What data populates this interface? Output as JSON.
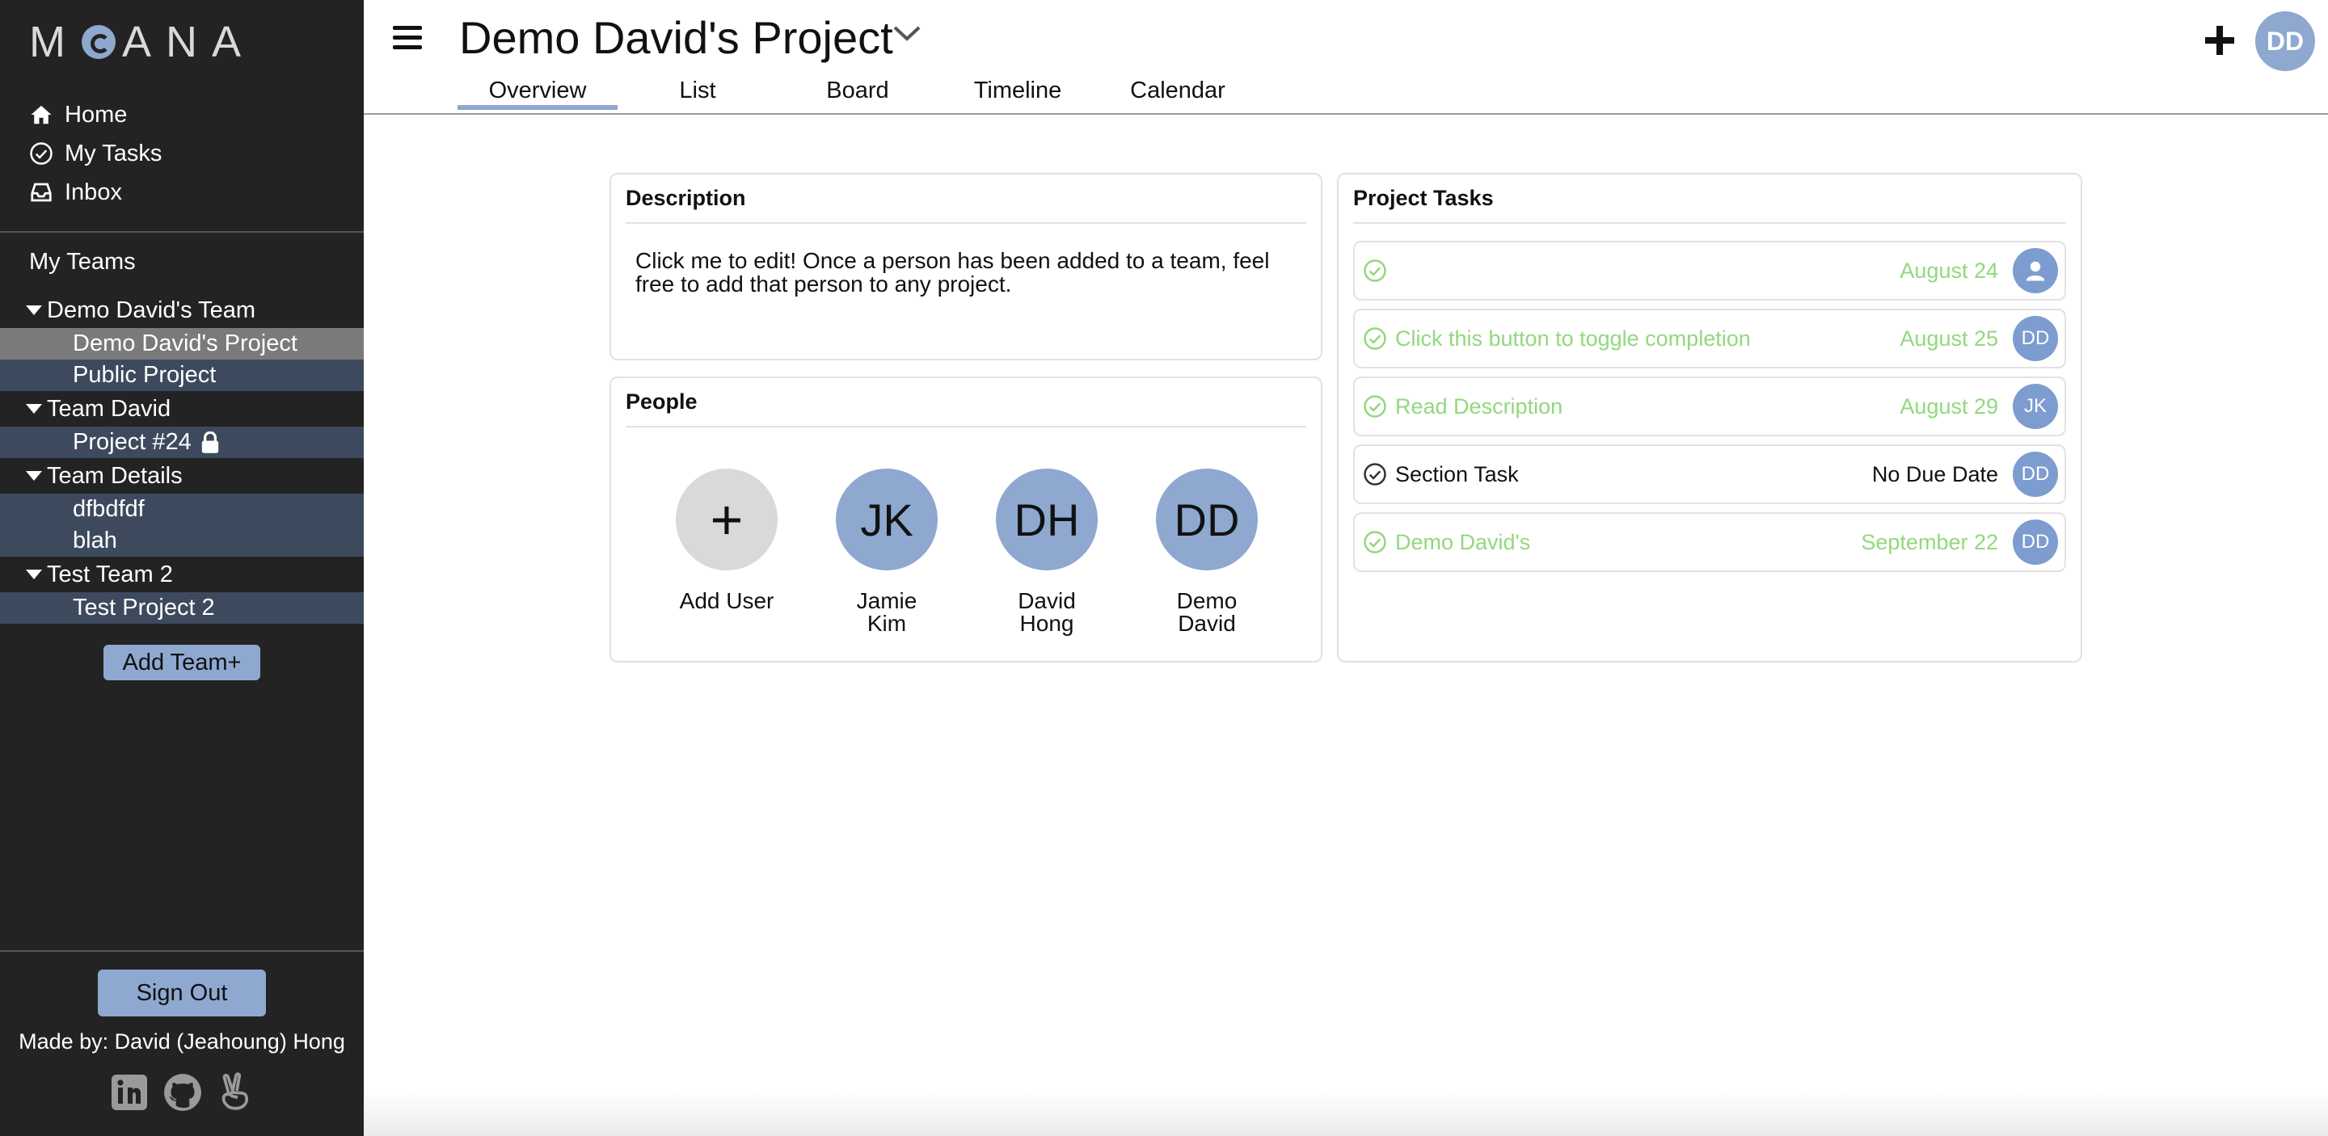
{
  "app": {
    "logo_text_left": "M",
    "logo_text_right": "ANA"
  },
  "sidebar": {
    "nav": [
      {
        "label": "Home",
        "icon": "home-icon"
      },
      {
        "label": "My Tasks",
        "icon": "check-circle-icon"
      },
      {
        "label": "Inbox",
        "icon": "inbox-icon"
      }
    ],
    "my_teams_label": "My Teams",
    "teams": [
      {
        "name": "Demo David's Team",
        "projects": [
          "Demo David's Project",
          "Public Project"
        ]
      },
      {
        "name": "Team David",
        "projects": [
          "Project #24"
        ]
      },
      {
        "name": "Team Details",
        "projects": [
          "dfbdfdf",
          "blah"
        ]
      },
      {
        "name": "Test Team 2",
        "projects": [
          "Test Project 2"
        ]
      }
    ],
    "add_team_label": "Add Team+",
    "sign_out_label": "Sign Out",
    "made_by": "Made by: David (Jeahoung) Hong"
  },
  "header": {
    "project_title": "Demo David's Project",
    "tabs": [
      "Overview",
      "List",
      "Board",
      "Timeline",
      "Calendar"
    ],
    "active_tab": "Overview",
    "user_initials": "DD"
  },
  "description": {
    "title": "Description",
    "text": "Click me to edit! Once a person has been added to a team, feel free to add that person to any project."
  },
  "people": {
    "title": "People",
    "add_label": "Add User",
    "members": [
      {
        "initials": "JK",
        "first": "Jamie",
        "last": "Kim"
      },
      {
        "initials": "DH",
        "first": "David",
        "last": "Hong"
      },
      {
        "initials": "DD",
        "first": "Demo",
        "last": "David"
      }
    ]
  },
  "tasks": {
    "title": "Project Tasks",
    "items": [
      {
        "name": "",
        "date": "August 24",
        "assignee": "",
        "completed": true
      },
      {
        "name": "Click this button to toggle completion",
        "date": "August 25",
        "assignee": "DD",
        "completed": true
      },
      {
        "name": "Read Description",
        "date": "August 29",
        "assignee": "JK",
        "completed": true
      },
      {
        "name": "Section Task",
        "date": "No Due Date",
        "assignee": "DD",
        "completed": false
      },
      {
        "name": "Demo David's",
        "date": "September 22",
        "assignee": "DD",
        "completed": true
      }
    ]
  },
  "colors": {
    "accent": "#8ea8d0",
    "sidebar_bg": "#232323",
    "complete_green": "#92d87e"
  }
}
